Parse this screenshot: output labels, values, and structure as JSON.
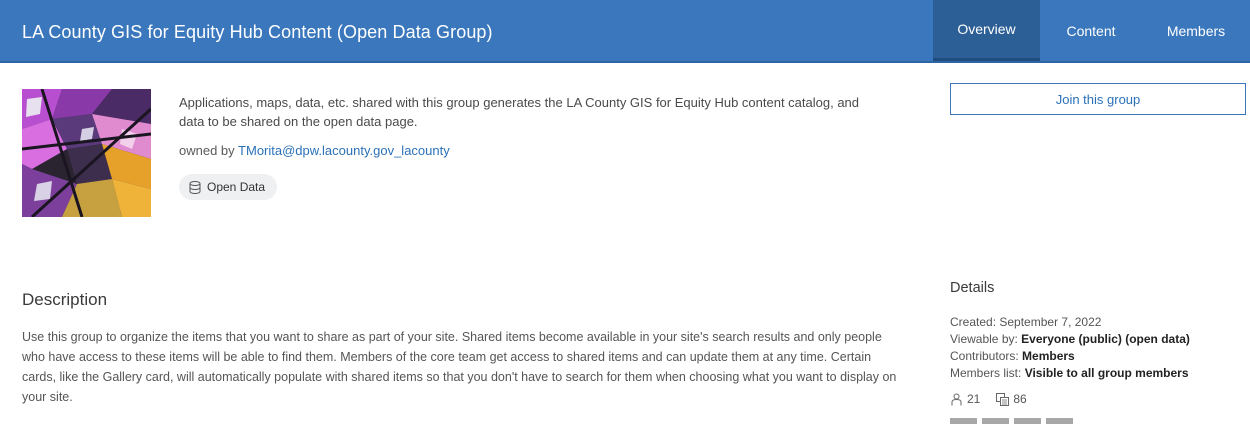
{
  "header": {
    "title": "LA County GIS for Equity Hub Content (Open Data Group)",
    "tabs": [
      {
        "label": "Overview",
        "active": true
      },
      {
        "label": "Content",
        "active": false
      },
      {
        "label": "Members",
        "active": false
      }
    ]
  },
  "group": {
    "thumbnail_icon": "abstract-map-thumbnail",
    "summary": "Applications, maps, data, etc. shared with this group generates the LA County GIS for Equity Hub content catalog, and data to be shared on the open data page.",
    "owned_by_prefix": "owned by",
    "owner": "TMorita@dpw.lacounty.gov_lacounty",
    "tag_label": "Open Data",
    "tag_icon": "database-icon",
    "join_label": "Join this group"
  },
  "description": {
    "heading": "Description",
    "text": "Use this group to organize the items that you want to share as part of your site. Shared items become available in your site's search results and only people who have access to these items will be able to find them. Members of the core team get access to shared items and can update them at any time. Certain cards, like the Gallery card, will automatically populate with shared items so that you don't have to search for them when choosing what you want to display on your site."
  },
  "details": {
    "heading": "Details",
    "created": "Created: September 7, 2022",
    "viewable_label": "Viewable by:",
    "viewable_value": "Everyone (public) (open data)",
    "contributors_label": "Contributors:",
    "contributors_value": "Members",
    "members_list_label": "Members list:",
    "members_list_value": "Visible to all group members",
    "member_count": "21",
    "item_count": "86",
    "member_icon": "user-icon",
    "item_icon": "items-icon"
  },
  "colors": {
    "header_bg": "#3a77bd",
    "active_tab_bg": "#2d5f97",
    "link": "#2b71b8"
  }
}
